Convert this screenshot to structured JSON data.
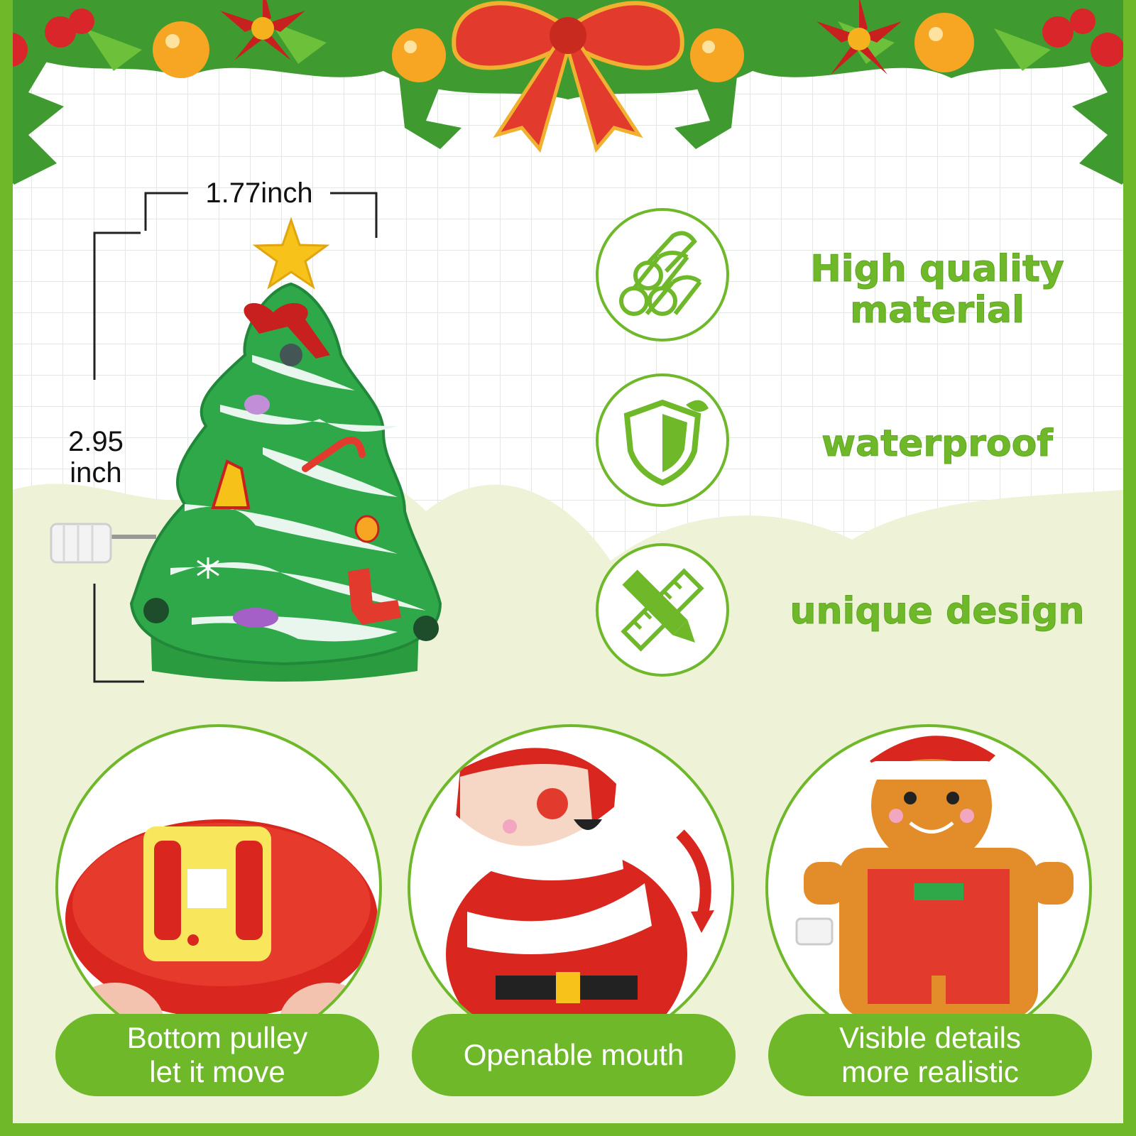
{
  "dimensions": {
    "width_label": "1.77inch",
    "height_label_line1": "2.95",
    "height_label_line2": "inch"
  },
  "features": [
    {
      "icon": "logs-icon",
      "line1": "High quality",
      "line2": "material"
    },
    {
      "icon": "shield-leaf-icon",
      "line1": "waterproof",
      "line2": ""
    },
    {
      "icon": "pencil-ruler-icon",
      "line1": "unique design",
      "line2": ""
    }
  ],
  "details": [
    {
      "photo": "red-toy-bottom",
      "line1": "Bottom pulley",
      "line2": "let it move"
    },
    {
      "photo": "santa-toy",
      "line1": "Openable mouth",
      "line2": ""
    },
    {
      "photo": "gingerbread-toy",
      "line1": "Visible details",
      "line2": "more realistic"
    }
  ],
  "colors": {
    "accent_green": "#6fb82a",
    "tree_green": "#2fa84a",
    "ribbon_red": "#e23b2e",
    "star_yellow": "#f7c21a"
  }
}
